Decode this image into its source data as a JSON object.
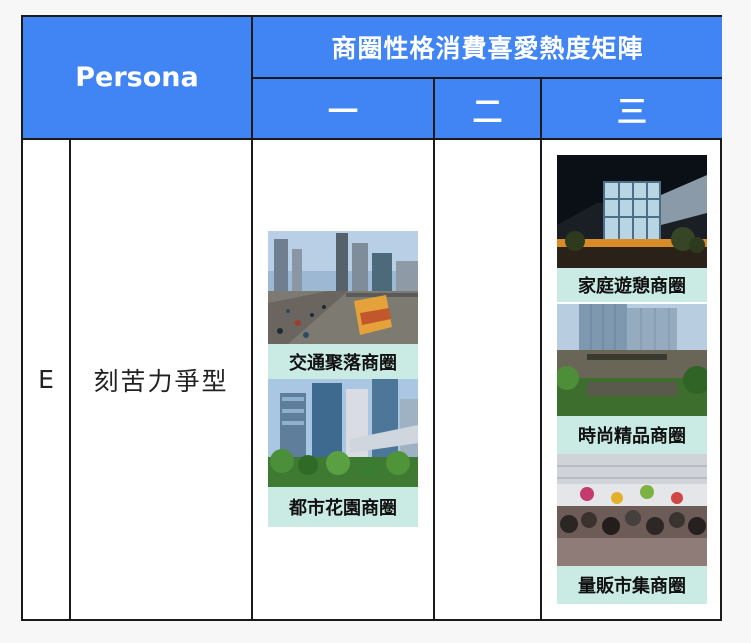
{
  "header": {
    "persona_label": "Persona",
    "matrix_title": "商圈性格消費喜愛熱度矩陣",
    "columns": [
      "一",
      "二",
      "三"
    ]
  },
  "row": {
    "code": "E",
    "name": "刻苦力爭型"
  },
  "column_1_cards": [
    {
      "caption": "交通聚落商圈",
      "photo": "city traffic street with bus"
    },
    {
      "caption": "都市花園商圈",
      "photo": "glass skyscrapers with trees"
    }
  ],
  "column_2_cards": [],
  "column_3_cards": [
    {
      "caption": "家庭遊憩商圈",
      "photo": "shopping mall at night"
    },
    {
      "caption": "時尚精品商圈",
      "photo": "high-rise office towers"
    },
    {
      "caption": "量販市集商圈",
      "photo": "crowded indoor market"
    }
  ],
  "colors": {
    "header_bg": "#4185f4",
    "caption_bg": "#c9ebe4",
    "border": "#1a1a1a"
  }
}
